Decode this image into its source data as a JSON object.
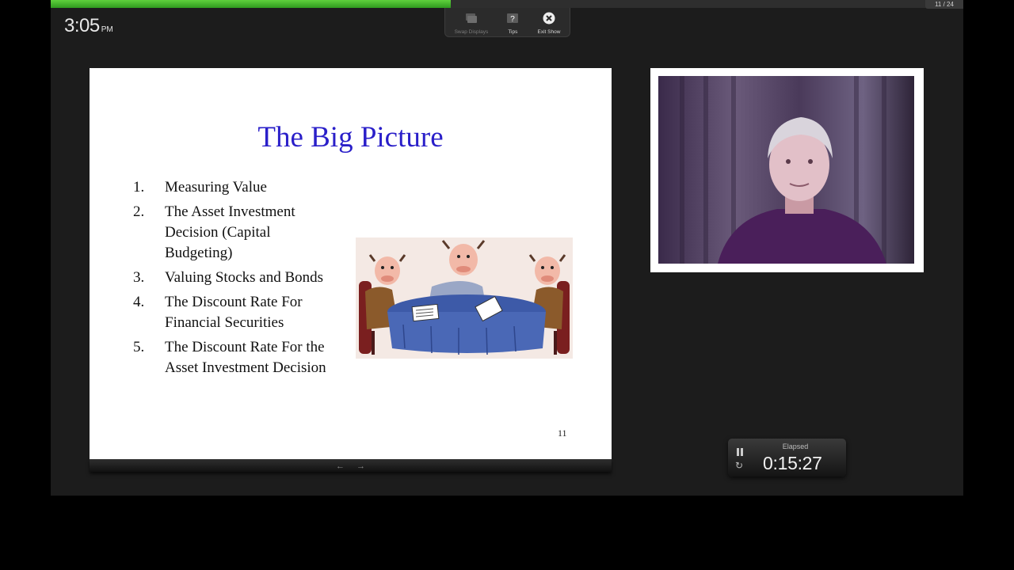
{
  "presenter": {
    "progress_fraction": 0.438,
    "slide_counter": "11 / 24",
    "clock": {
      "time": "3:05",
      "ampm": "PM"
    },
    "toolbar": {
      "swap_displays": {
        "label": "Swap Displays",
        "icon": "swap-displays-icon"
      },
      "tips": {
        "label": "Tips",
        "icon": "tips-icon"
      },
      "exit_show": {
        "label": "Exit Show",
        "icon": "close-icon"
      }
    },
    "nav": {
      "prev_icon": "arrow-left-icon",
      "next_icon": "arrow-right-icon"
    },
    "timer": {
      "label": "Elapsed",
      "value": "0:15:27",
      "pause_icon": "pause-icon",
      "reset_icon": "reset-icon"
    }
  },
  "slide": {
    "title": "The Big Picture",
    "items": [
      {
        "num": "1.",
        "text": "Measuring Value"
      },
      {
        "num": "2.",
        "text": "The Asset Investment Decision (Capital Budgeting)"
      },
      {
        "num": "3.",
        "text": "Valuing Stocks and Bonds"
      },
      {
        "num": "4.",
        "text": "The Discount Rate For Financial Securities"
      },
      {
        "num": "5.",
        "text": "The Discount Rate For the Asset Investment Decision"
      }
    ],
    "page_number": "11"
  },
  "colors": {
    "progress": "#3fae28",
    "slide_title": "#2a1fc9",
    "window_bg": "#1c1c1c"
  }
}
